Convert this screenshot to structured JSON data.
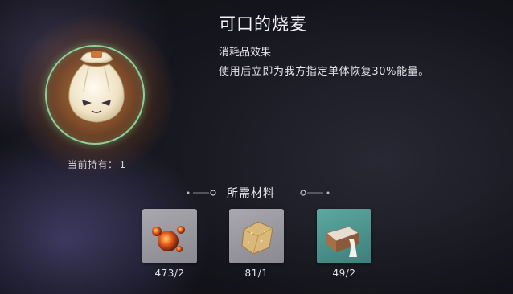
{
  "item": {
    "name": "可口的烧麦",
    "holding_label": "当前持有：",
    "holding_count": "1",
    "effect_label": "消耗品效果",
    "effect_desc": "使用后立即为我方指定单体恢复30%能量。",
    "icon": "shaomai-dumpling-icon"
  },
  "materials": {
    "title": "所需材料",
    "items": [
      {
        "icon": "ember-orbs-icon",
        "count": "473/2",
        "rarity_color": "#9a999f"
      },
      {
        "icon": "grain-cube-icon",
        "count": "81/1",
        "rarity_color": "#9a999f"
      },
      {
        "icon": "milk-carton-icon",
        "count": "49/2",
        "rarity_color": "#4f958f"
      }
    ]
  },
  "colors": {
    "ring": "#8fcf9a",
    "text": "#e4e2e8"
  }
}
